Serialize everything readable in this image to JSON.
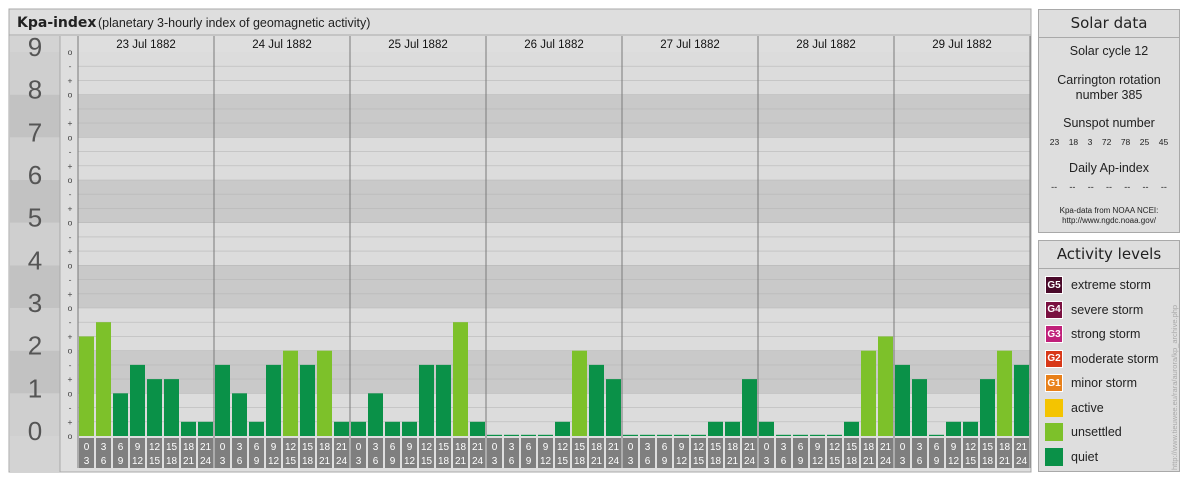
{
  "header": {
    "title": "Kpa-index",
    "subtitle": "(planetary 3-hourly index of geomagnetic activity)"
  },
  "solar": {
    "title": "Solar data",
    "cycle": "Solar cycle 12",
    "carrington_line1": "Carrington rotation",
    "carrington_line2": "number 385",
    "sunspot_title": "Sunspot number",
    "sunspot_values": [
      "23",
      "18",
      "3",
      "72",
      "78",
      "25",
      "45"
    ],
    "ap_title": "Daily Ap-index",
    "ap_values": [
      "--",
      "--",
      "--",
      "--",
      "--",
      "--",
      "--"
    ],
    "source_line1": "Kpa-data from NOAA NCEI:",
    "source_line2": "http://www.ngdc.noaa.gov/"
  },
  "levels": {
    "title": "Activity levels",
    "items": [
      {
        "badge": "G5",
        "label": "extreme storm",
        "color": "#4a0a2a"
      },
      {
        "badge": "G4",
        "label": "severe storm",
        "color": "#7a1040"
      },
      {
        "badge": "G3",
        "label": "strong storm",
        "color": "#c0207a"
      },
      {
        "badge": "G2",
        "label": "moderate storm",
        "color": "#d83818"
      },
      {
        "badge": "G1",
        "label": "minor storm",
        "color": "#e8801a"
      },
      {
        "badge": "",
        "label": "active",
        "color": "#f4c400"
      },
      {
        "badge": "",
        "label": "unsettled",
        "color": "#7dc12a"
      },
      {
        "badge": "",
        "label": "quiet",
        "color": "#0a9148"
      }
    ]
  },
  "watermark": "http://www.tieuwee.eu/rara/aurora/kp_archive.php",
  "chart_data": {
    "type": "bar",
    "title": "Kpa-index",
    "ylim": [
      0,
      9
    ],
    "y_ticks": [
      "0",
      "1",
      "2",
      "3",
      "4",
      "5",
      "6",
      "7",
      "8",
      "9"
    ],
    "minor_labels": [
      "o",
      "+",
      "-",
      "o",
      "+",
      "-",
      "o",
      "+",
      "-",
      "o",
      "+",
      "-",
      "o",
      "+",
      "-",
      "o",
      "+",
      "-",
      "o",
      "+",
      "-",
      "o",
      "+",
      "-",
      "o",
      "+",
      "-",
      "o"
    ],
    "days": [
      "23 Jul 1882",
      "24 Jul 1882",
      "25 Jul 1882",
      "26 Jul 1882",
      "27 Jul 1882",
      "28 Jul 1882",
      "29 Jul 1882"
    ],
    "interval_start": [
      "0",
      "3",
      "6",
      "9",
      "12",
      "15",
      "18",
      "21"
    ],
    "interval_end": [
      "3",
      "6",
      "9",
      "12",
      "15",
      "18",
      "21",
      "24"
    ],
    "colors": {
      "quiet": "#0a9148",
      "unsettled": "#7dc12a"
    },
    "values": [
      2.333,
      2.667,
      1.0,
      1.667,
      1.333,
      1.333,
      0.333,
      0.333,
      1.667,
      1.0,
      0.333,
      1.667,
      2.0,
      1.667,
      2.0,
      0.333,
      0.333,
      1.0,
      0.333,
      0.333,
      1.667,
      1.667,
      2.667,
      0.333,
      0.0,
      0.0,
      0.0,
      0.0,
      0.333,
      2.0,
      1.667,
      1.333,
      0.0,
      0.0,
      0.0,
      0.0,
      0.0,
      0.333,
      0.333,
      1.333,
      0.333,
      0.0,
      0.0,
      0.0,
      0.0,
      0.333,
      2.0,
      2.333,
      1.667,
      1.333,
      0.0,
      0.333,
      0.333,
      1.333,
      2.0,
      1.667
    ]
  }
}
